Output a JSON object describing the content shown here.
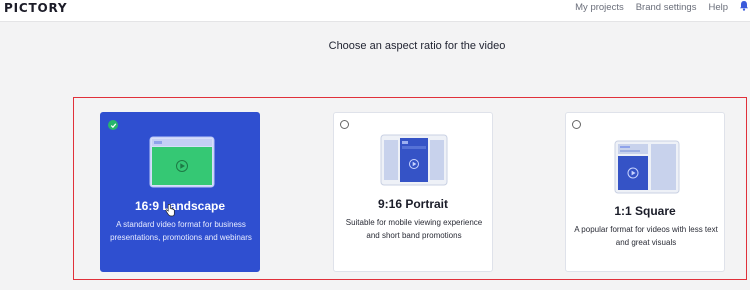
{
  "app": {
    "logo": "PICTORY"
  },
  "nav": {
    "items": [
      "My projects",
      "Brand settings",
      "Help"
    ]
  },
  "page": {
    "heading": "Choose an aspect ratio for the video"
  },
  "options": [
    {
      "title": "16:9 Landscape",
      "description": "A standard video format for business presentations, promotions and webinars",
      "selected": true
    },
    {
      "title": "9:16 Portrait",
      "description": "Suitable for mobile viewing experience and short band promotions",
      "selected": false
    },
    {
      "title": "1:1 Square",
      "description": "A popular format for videos with less text and great visuals",
      "selected": false
    }
  ],
  "colors": {
    "selected_card": "#2f4fd0",
    "check": "#27b56c",
    "highlight_border": "#e0303a",
    "video_green": "#2ecc71"
  },
  "icons": {
    "notification": "bell-icon",
    "selected": "check-icon",
    "play": "play-icon"
  }
}
